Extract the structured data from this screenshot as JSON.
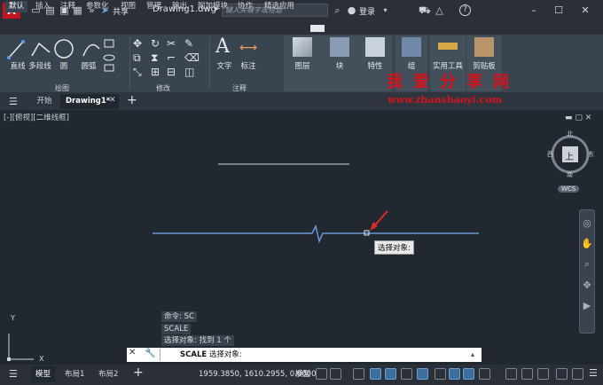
{
  "app": {
    "logo": "A",
    "share_label": "共享",
    "doc_title": "Drawing1.dwg",
    "search_placeholder": "键入关键字或短语",
    "login_label": "登录",
    "help_label": "?"
  },
  "ribbon_tabs": [
    "默认",
    "插入",
    "注释",
    "参数化",
    "视图",
    "管理",
    "输出",
    "附加模块",
    "协作",
    "精选应用"
  ],
  "ribbon": {
    "draw": {
      "line": "直线",
      "polyline": "多段线",
      "circle": "圆",
      "arc": "圆弧",
      "panel": "绘图"
    },
    "modify": {
      "panel": "修改"
    },
    "annotation": {
      "text": "文字",
      "dimension": "标注",
      "panel": "注释"
    },
    "layers": "图层",
    "block": "块",
    "properties": "特性",
    "group": "组",
    "utilities": "实用工具",
    "clipboard": "剪贴板"
  },
  "file_tabs": {
    "home": "开始",
    "drawing": "Drawing1*",
    "add": "+"
  },
  "viewport_label": "[-][俯视][二维线框]",
  "viewcube": {
    "top": "上",
    "north": "北",
    "south": "南",
    "east": "东",
    "west": "西",
    "wcs": "WCS"
  },
  "tooltip": "选择对象:",
  "ucs": {
    "x": "X",
    "y": "Y"
  },
  "command": {
    "history": [
      "命令: SC",
      "SCALE",
      "选择对象: 找到 1 个"
    ],
    "keyword": "SCALE",
    "prompt": "选择对象:"
  },
  "status": {
    "tabs": [
      "模型",
      "布局1",
      "布局2"
    ],
    "coords": "1959.3850, 1610.2955, 0.0000",
    "space": "模型"
  },
  "watermark": {
    "title": "我爱分享网",
    "url": "www.zhanshaoyi.com"
  },
  "colors": {
    "accent": "#c4141e",
    "selection_line": "#6a98d8",
    "canvas": "#212830"
  }
}
